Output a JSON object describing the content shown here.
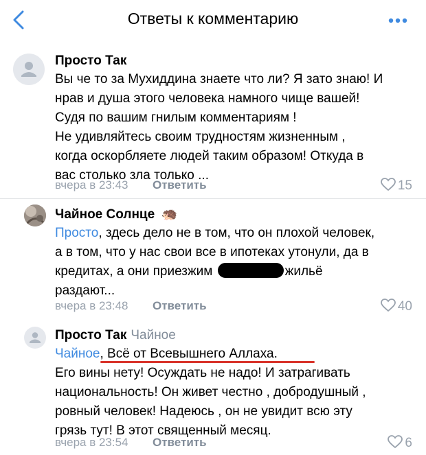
{
  "header": {
    "title": "Ответы к комментарию",
    "back_icon": "chevron-left-icon",
    "more_icon": "more-dots-icon"
  },
  "comments": [
    {
      "author": "Просто Так",
      "text": "Вы че то за Мухиддина знаете что ли? Я зато знаю! И\nнрав и душа этого человека намного чище вашей!\nСудя по вашим гнилым комментариям !\nНе удивляйтесь своим трудностям жизненным ,\nкогда оскорбляете людей таким образом! Откуда в\nвас столько зла только ...",
      "time": "вчера в 23:43",
      "reply_label": "Ответить",
      "likes": "15"
    },
    {
      "author": "Чайное Солнце",
      "author_emoji": "🦔",
      "mention": "Просто",
      "text_1": ", здесь дело не в том, что он плохой человек,\nа в том, что у нас свои все в ипотеках утонули, да в\nкредитах, а они приезжим ",
      "text_2": "жильё\nраздают...",
      "time": "вчера в 23:48",
      "reply_label": "Ответить",
      "likes": "40"
    },
    {
      "author": "Просто Так",
      "reply_to": "Чайное",
      "mention": "Чайное",
      "highlight": ", Всё от Всевышнего Аллаха.",
      "text": "Его вины нету! Осуждать не надо! И затрагивать\nнациональность! Он живет честно , добродушный ,\nровный человек! Надеюсь , он не увидит всю эту\nгрязь тут! В этот священный месяц.",
      "time": "вчера в 23:54",
      "reply_label": "Ответить",
      "likes": "6"
    }
  ],
  "colors": {
    "link": "#3f8ae0",
    "meta": "#99a2ad",
    "underline": "#d9342b",
    "accent": "#3f8ae0"
  }
}
